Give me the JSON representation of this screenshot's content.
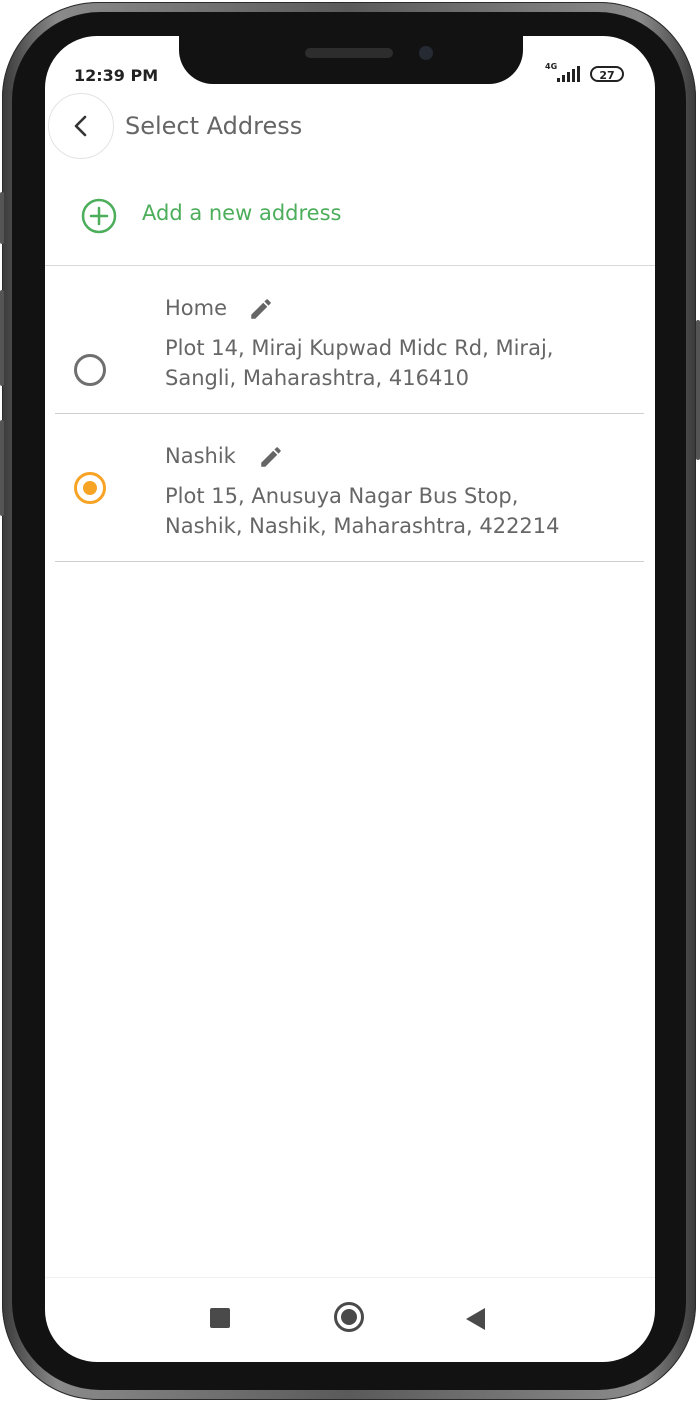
{
  "status_bar": {
    "time": "12:39 PM",
    "network": "4G",
    "battery": "27"
  },
  "header": {
    "title": "Select Address",
    "back_icon": "chevron-left-icon"
  },
  "add_address": {
    "label": "Add a new address",
    "icon": "plus-circle-icon",
    "color": "#4cae5b"
  },
  "addresses": [
    {
      "name": "Home",
      "line1": "Plot 14, Miraj Kupwad Midc Rd, Miraj,",
      "line2": "Sangli, Maharashtra, 416410",
      "selected": false
    },
    {
      "name": "Nashik",
      "line1": "Plot 15, Anusuya Nagar Bus Stop,",
      "line2": "Nashik, Nashik, Maharashtra, 422214",
      "selected": true
    }
  ],
  "colors": {
    "radio_selected": "#f7a325",
    "radio_unselected": "#6f6f6f",
    "text": "#666666"
  },
  "nav_bar": {
    "icons": [
      "recents-square-icon",
      "home-circle-icon",
      "back-triangle-icon"
    ]
  }
}
